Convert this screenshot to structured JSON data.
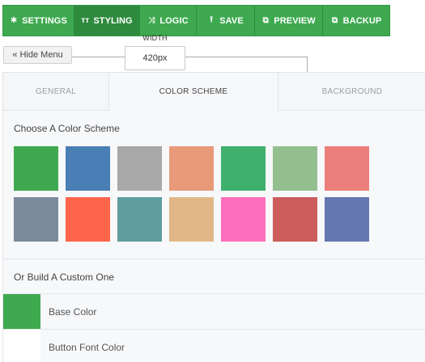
{
  "toolbar": {
    "buttons": [
      {
        "label": "SETTINGS",
        "icon": "gear-icon"
      },
      {
        "label": "STYLING",
        "icon": "text-style-icon"
      },
      {
        "label": "LOGIC",
        "icon": "shuffle-icon"
      },
      {
        "label": "SAVE",
        "icon": "upload-icon"
      },
      {
        "label": "PREVIEW",
        "icon": "external-link-icon"
      },
      {
        "label": "BACKUP",
        "icon": "external-link-icon"
      }
    ],
    "active": "STYLING",
    "color": "#3ea94f"
  },
  "hide_menu_label": "« Hide Menu",
  "width_control": {
    "label": "WIDTH",
    "value": "420px"
  },
  "tabs": {
    "general": "GENERAL",
    "color_scheme": "COLOR SCHEME",
    "background": "BACKGROUND",
    "active": "COLOR SCHEME"
  },
  "color_scheme": {
    "title": "Choose A Color Scheme",
    "swatches": [
      "#3ea94f",
      "#4a7fb5",
      "#a8a8a8",
      "#e8997a",
      "#3fb06e",
      "#93bf8f",
      "#ec7f7c",
      "#7b8b9c",
      "#fd654b",
      "#5e9e9e",
      "#e0b887",
      "#fd6fbc",
      "#cd5d5d",
      "#6577b0"
    ]
  },
  "custom": {
    "title": "Or Build A Custom One",
    "rows": [
      {
        "label": "Base Color",
        "color": "#3ea94f"
      },
      {
        "label": "Button Font Color",
        "color": "#ffffff"
      }
    ]
  }
}
